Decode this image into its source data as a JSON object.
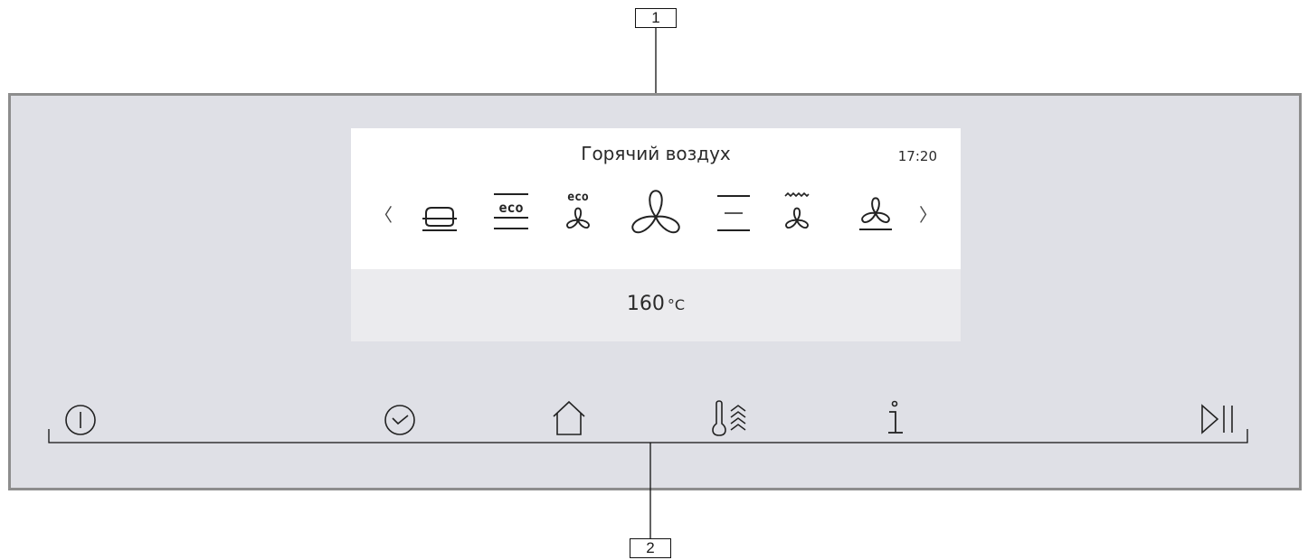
{
  "callouts": {
    "top": "1",
    "bottom": "2"
  },
  "display": {
    "mode_title": "Горячий воздух",
    "clock": "17:20",
    "temperature_value": "160",
    "temperature_unit": "°C",
    "prev_arrow": "〈",
    "next_arrow": "〉",
    "eco_label": "eco",
    "modes": [
      "top-bottom-heat-icon",
      "eco-heat-icon",
      "eco-fan-icon",
      "hot-air-fan-icon",
      "conventional-heat-icon",
      "grill-fan-icon",
      "fan-bottom-heat-icon"
    ]
  },
  "controls": [
    "power-icon",
    "timer-icon",
    "home-icon",
    "fast-heat-icon",
    "info-icon",
    "start-pause-icon"
  ],
  "colors": {
    "panel": "#dfe0e6",
    "panel_border": "#8d8d8d",
    "screen": "#ffffff",
    "screen_bottom": "#ebebee"
  }
}
